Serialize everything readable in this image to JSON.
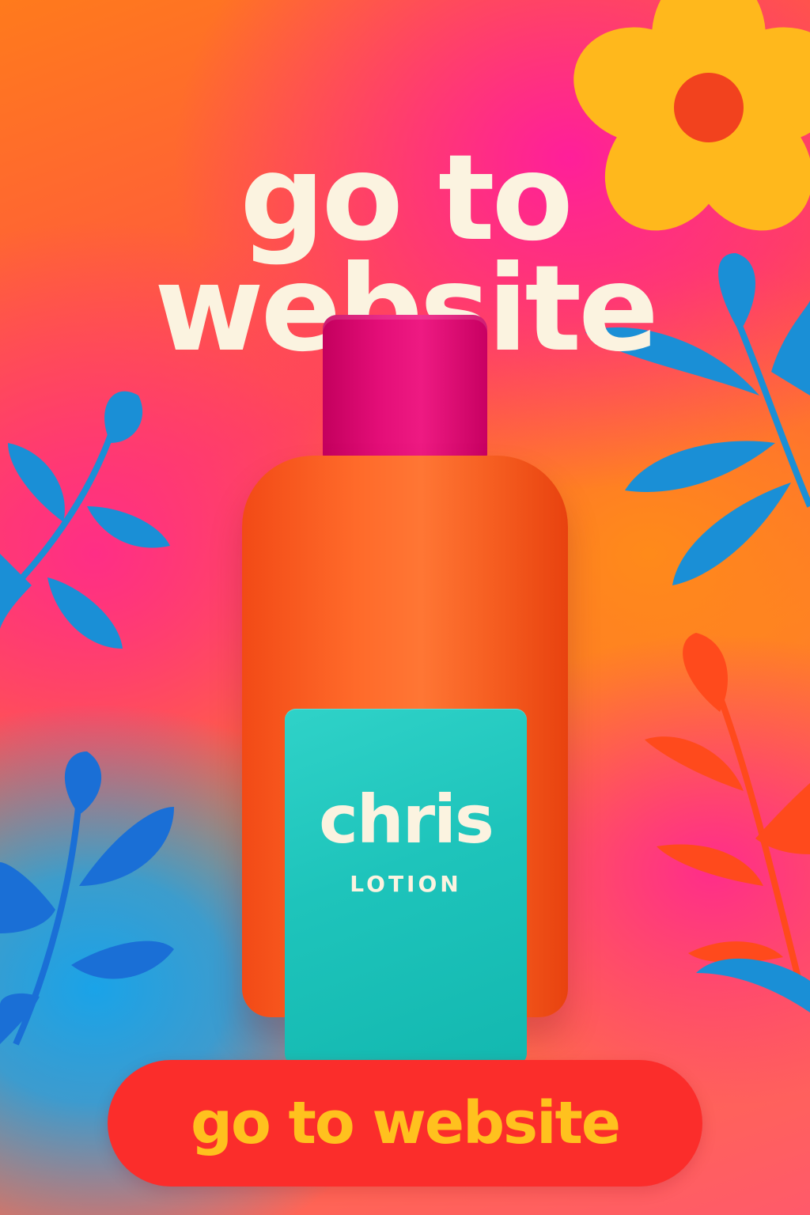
{
  "headline": {
    "line1": "go to",
    "line2": "website"
  },
  "product": {
    "brand": "chris",
    "name": "LOTION"
  },
  "cta": {
    "label": "go to website"
  },
  "colors": {
    "headline_text": "#fbf3e0",
    "cap": "#e40e78",
    "bottle": "#ff6a2a",
    "label": "#1ec4bb",
    "cta_background": "#fb2d2b",
    "cta_text": "#ffc11e",
    "flower_petals": "#ffb81c",
    "flower_center": "#f2421e",
    "leaves_blue": "#1a8fd6",
    "leaves_orange": "#ff4a1c"
  },
  "decorations": [
    "flower-icon",
    "leaf-branch-icon"
  ]
}
